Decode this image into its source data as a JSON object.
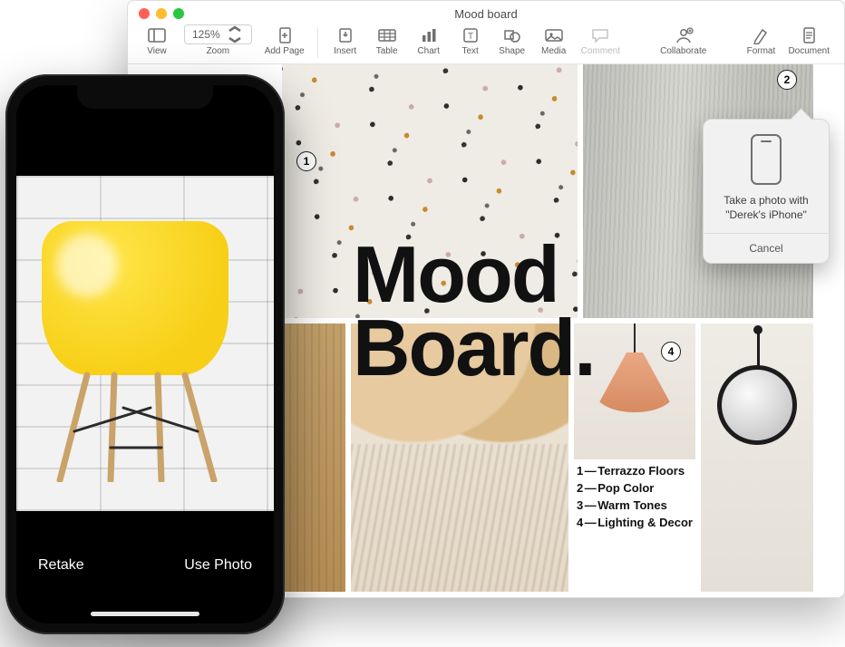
{
  "mac": {
    "window_title": "Mood board",
    "toolbar": {
      "view": "View",
      "zoom_label": "Zoom",
      "zoom_value": "125%",
      "add_page": "Add Page",
      "insert": "Insert",
      "table": "Table",
      "chart": "Chart",
      "text": "Text",
      "shape": "Shape",
      "media": "Media",
      "comment": "Comment",
      "collaborate": "Collaborate",
      "format": "Format",
      "document": "Document"
    },
    "document": {
      "big_title_line1": "Mood",
      "big_title_line2": "Board.",
      "markers": {
        "m1": "1",
        "m2": "2",
        "m4": "4"
      },
      "legend": [
        {
          "n": "1",
          "t": "Terrazzo Floors"
        },
        {
          "n": "2",
          "t": "Pop Color"
        },
        {
          "n": "3",
          "t": "Warm Tones"
        },
        {
          "n": "4",
          "t": "Lighting & Decor"
        }
      ]
    },
    "popover": {
      "line1": "Take a photo with",
      "line2": "\"Derek's iPhone\"",
      "cancel": "Cancel"
    }
  },
  "iphone": {
    "retake": "Retake",
    "use_photo": "Use Photo"
  }
}
